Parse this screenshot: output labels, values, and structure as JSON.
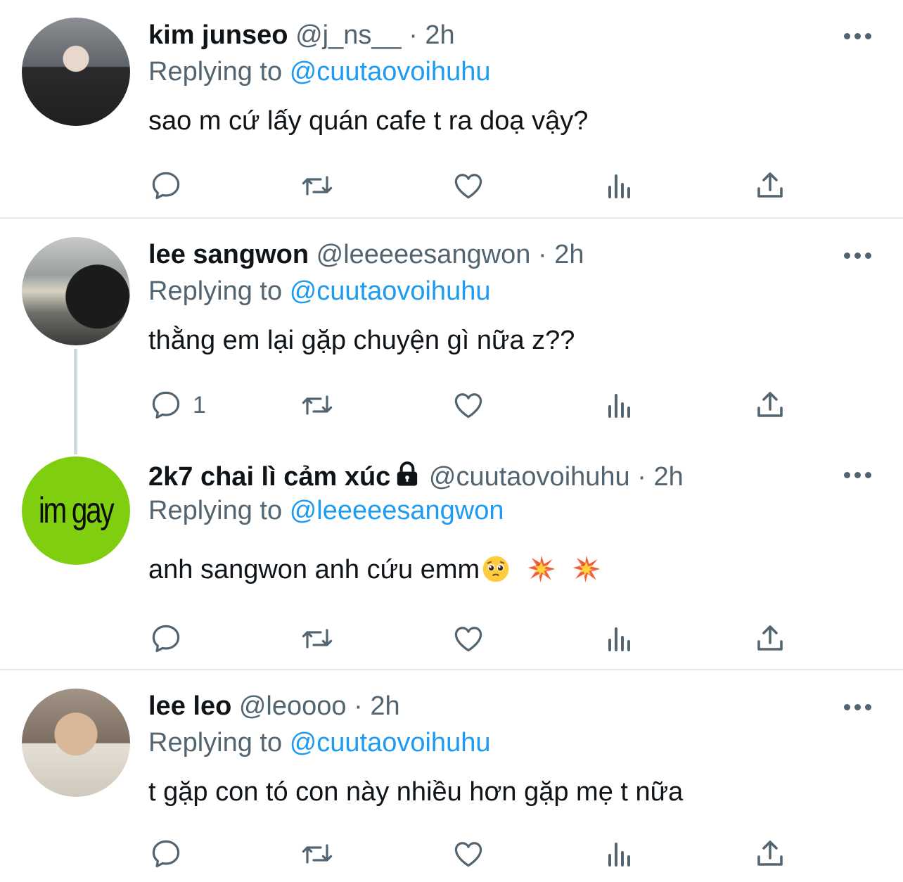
{
  "tweets": [
    {
      "name": "kim junseo",
      "handle": "@j_ns__",
      "time": "· 2h",
      "replying_prefix": "Replying to",
      "replying_to": "@cuutaovoihuhu",
      "text": "sao m cứ lấy quán cafe t ra doạ vậy?",
      "reply_count": ""
    },
    {
      "name": "lee sangwon",
      "handle": "@leeeeesangwon",
      "time": "· 2h",
      "replying_prefix": "Replying to",
      "replying_to": "@cuutaovoihuhu",
      "text": "thằng em lại gặp chuyện gì nữa z??",
      "reply_count": "1"
    },
    {
      "name": "2k7 chai lì cảm xúc",
      "handle": "@cuutaovoihuhu",
      "time": "· 2h",
      "replying_prefix": "Replying to",
      "replying_to": "@leeeeesangwon",
      "text": "anh sangwon anh cứu emm",
      "avatar_text": "im gay",
      "reply_count": ""
    },
    {
      "name": "lee leo",
      "handle": "@leoooo",
      "time": "· 2h",
      "replying_prefix": "Replying to",
      "replying_to": "@cuutaovoihuhu",
      "text": "t gặp con tó con này nhiều hơn gặp mẹ t nữa",
      "reply_count": ""
    }
  ],
  "colors": {
    "link": "#1d9bf0",
    "secondary_text": "#536471",
    "primary_text": "#0f1419",
    "avatar_green": "#7fcf10"
  },
  "icons": [
    "reply-icon",
    "retweet-icon",
    "like-icon",
    "views-icon",
    "share-icon",
    "more-icon",
    "lock-icon"
  ]
}
